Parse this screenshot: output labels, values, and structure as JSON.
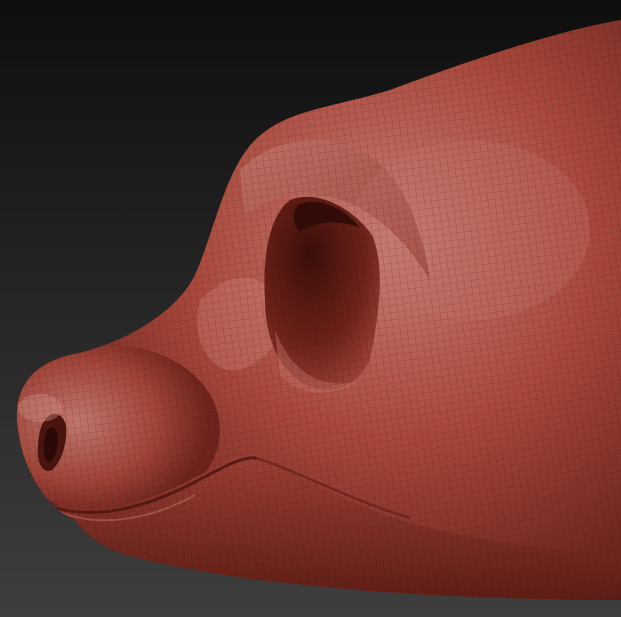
{
  "scene": {
    "subject": "sculpted-head-mesh",
    "colors": {
      "background_top": "#0e0e0e",
      "background_bottom": "#3e3e3e",
      "skin_base": "#a8483c",
      "skin_highlight": "#c97f76",
      "skin_shadow": "#5a1a14",
      "cavity_dark": "#3a0e0a",
      "wireframe": "#3b0f0b"
    }
  }
}
